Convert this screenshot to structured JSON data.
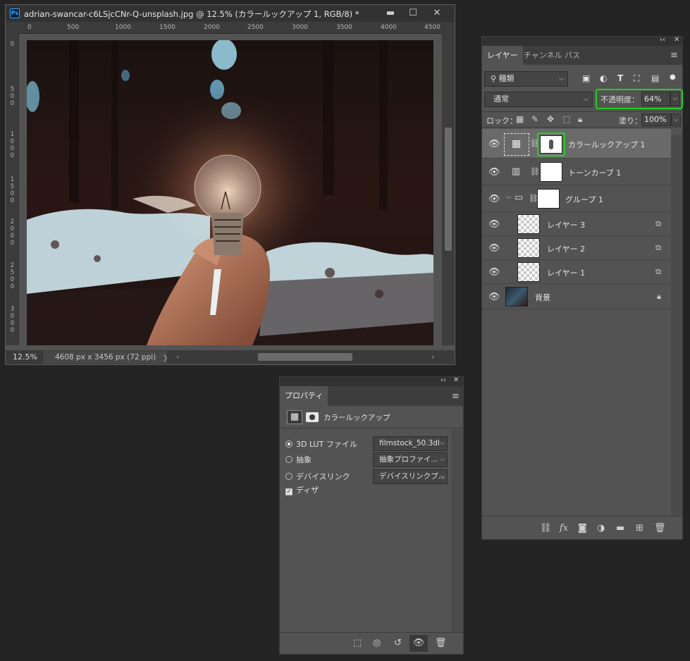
{
  "document": {
    "title": "adrian-swancar-c6LSjcCNr-Q-unsplash.jpg @ 12.5% (カラールックアップ 1, RGB/8) *",
    "app_badge": "Ps",
    "ruler_h_labels": [
      "0",
      "500",
      "1000",
      "1500",
      "2000",
      "2500",
      "3000",
      "3500",
      "4000",
      "4500"
    ],
    "ruler_v_labels": [
      "0",
      "500",
      "1000",
      "1500",
      "2000",
      "2500",
      "3000"
    ],
    "zoom": "12.5%",
    "info": "4608 px x 3456 px (72 ppi)",
    "info_arrow": "〉",
    "window_buttons": [
      "▬",
      "☐",
      "✕"
    ]
  },
  "layers_panel": {
    "tabs": [
      "レイヤー",
      "チャンネル",
      "パス"
    ],
    "active_tab": "レイヤー",
    "filter_label": "種類",
    "blend_mode": "通常",
    "opacity_label": "不透明度：",
    "opacity_value": "64%",
    "lock_label": "ロック：",
    "fill_label": "塗り：",
    "fill_value": "100%",
    "layers": [
      {
        "name": "カラールックアップ 1",
        "type": "adjustment-lut",
        "selected": true,
        "visible": true
      },
      {
        "name": "トーンカーブ 1",
        "type": "adjustment-curves",
        "selected": false,
        "visible": true
      },
      {
        "name": "グループ 1",
        "type": "group",
        "selected": false,
        "visible": true
      },
      {
        "name": "レイヤー 3",
        "type": "pixel",
        "selected": false,
        "visible": true
      },
      {
        "name": "レイヤー 2",
        "type": "pixel",
        "selected": false,
        "visible": true
      },
      {
        "name": "レイヤー 1",
        "type": "pixel",
        "selected": false,
        "visible": true
      },
      {
        "name": "背景",
        "type": "background",
        "selected": false,
        "visible": true
      }
    ]
  },
  "properties_panel": {
    "tab": "プロパティ",
    "header_label": "カラールックアップ",
    "options": [
      {
        "label": "3D LUT ファイル",
        "checked": true,
        "dropdown": "filmstock_50.3dl"
      },
      {
        "label": "抽象",
        "checked": false,
        "dropdown": "抽象プロファイ..."
      },
      {
        "label": "デバイスリンク",
        "checked": false,
        "dropdown": "デバイスリンクプ..."
      }
    ],
    "dither_label": "ディザ",
    "dither_checked": true
  },
  "colors": {
    "highlight_green": "#22d11f",
    "panel_bg": "#535353",
    "app_bg": "#242424"
  }
}
